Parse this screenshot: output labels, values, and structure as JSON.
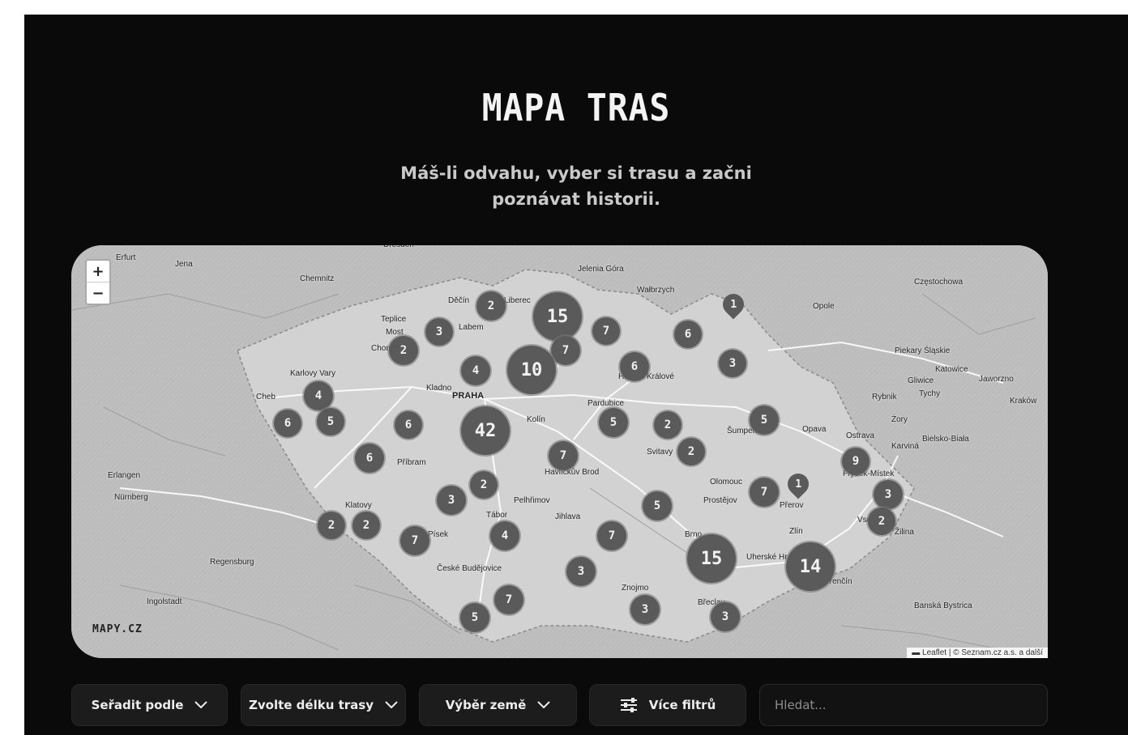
{
  "header": {
    "title": "MAPA TRAS",
    "subtitle_line1": "Máš-li odvahu, vyber si trasu a začni",
    "subtitle_line2": "poznávat historii."
  },
  "map": {
    "zoom_in": "+",
    "zoom_out": "−",
    "logo": "MAPY.CZ",
    "attribution": "▬ Leaflet | © Seznam.cz a.s. a další",
    "places": [
      "Erfurt",
      "Jena",
      "Chemnitz",
      "Dresden",
      "Jelenia Góra",
      "Wałbrzych",
      "Częstochowa",
      "Děčín",
      "Liberec",
      "Teplice",
      "Most",
      "Labem",
      "Chom",
      "Opole",
      "Karlovy Vary",
      "Kladno",
      "PRAHA",
      "Hradec Králové",
      "Pardubice",
      "Piekary Śląskie",
      "Katowice",
      "Gliwice",
      "Jaworzno",
      "Rybnik",
      "Tychy",
      "Kraków",
      "Cheb",
      "Kolín",
      "Šumperk",
      "Opava",
      "Ostrava",
      "Karviná",
      "Żory",
      "Bielsko-Biała",
      "Příbram",
      "Havlíčkův Brod",
      "Svitavy",
      "Erlangen",
      "Nürnberg",
      "Klatovy",
      "Pelhřimov",
      "Tábor",
      "Jihlava",
      "Olomouc",
      "Prostějov",
      "Přerov",
      "Frýdek-Místek",
      "Vsetín",
      "Žilina",
      "Písek",
      "Zlín",
      "Brno",
      "Regensburg",
      "Uherské Hr",
      "České Budějovice",
      "Trenčín",
      "Znojmo",
      "Ingolstadt",
      "Břeclav",
      "Banská Bystrica"
    ],
    "clusters": [
      {
        "count": "2"
      },
      {
        "count": "15"
      },
      {
        "count": "7"
      },
      {
        "count": "6"
      },
      {
        "count": "3"
      },
      {
        "count": "2"
      },
      {
        "count": "7"
      },
      {
        "count": "4"
      },
      {
        "count": "10"
      },
      {
        "count": "6"
      },
      {
        "count": "3"
      },
      {
        "count": "4"
      },
      {
        "count": "6"
      },
      {
        "count": "5"
      },
      {
        "count": "6"
      },
      {
        "count": "42"
      },
      {
        "count": "5"
      },
      {
        "count": "2"
      },
      {
        "count": "5"
      },
      {
        "count": "6"
      },
      {
        "count": "7"
      },
      {
        "count": "2"
      },
      {
        "count": "9"
      },
      {
        "count": "2"
      },
      {
        "count": "3"
      },
      {
        "count": "7"
      },
      {
        "count": "3"
      },
      {
        "count": "5"
      },
      {
        "count": "2"
      },
      {
        "count": "2"
      },
      {
        "count": "2"
      },
      {
        "count": "7"
      },
      {
        "count": "4"
      },
      {
        "count": "7"
      },
      {
        "count": "15"
      },
      {
        "count": "14"
      },
      {
        "count": "3"
      },
      {
        "count": "7"
      },
      {
        "count": "5"
      },
      {
        "count": "3"
      },
      {
        "count": "3"
      }
    ],
    "pins": [
      {
        "count": "1"
      },
      {
        "count": "1"
      }
    ]
  },
  "filters": {
    "sort_label": "Seřadit podle",
    "length_label": "Zvolte délku trasy",
    "country_label": "Výběr země",
    "more_label": "Více filtrů",
    "search_placeholder": "Hledat..."
  },
  "icons": {
    "chevron": "chevron-down-icon",
    "filters": "sliders-icon"
  },
  "colors": {
    "background": "#0a0a0a",
    "cluster": "#5a5a5a",
    "button": "#1c1c1c"
  }
}
